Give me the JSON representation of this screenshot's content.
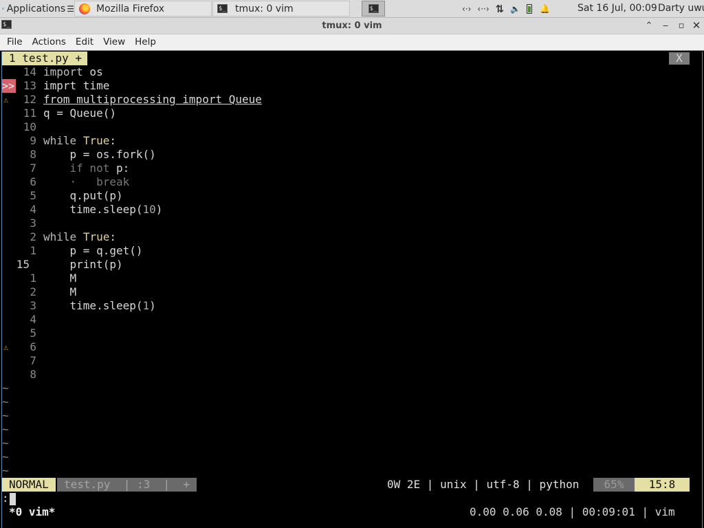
{
  "panel": {
    "applications_label": "Applications",
    "applications_arrow": "☰",
    "tasks": [
      {
        "label": "Mozilla Firefox",
        "icon": "firefox-icon"
      },
      {
        "label": "tmux: 0 vim",
        "icon": "terminal-icon"
      }
    ],
    "terminal_launcher_glyph": "$_",
    "tray": {
      "net1": "‹·›",
      "net2": "‹··›",
      "updown": "⇅",
      "volume": "🔈",
      "bell": "🔔"
    },
    "clock": "Sat 16 Jul, 00:09",
    "user": "Darty uwu"
  },
  "window": {
    "title": "tmux: 0 vim",
    "icon_glyph": "$_",
    "buttons": {
      "minimize": "⌃",
      "restore": "‒",
      "maximize": "▫",
      "close": "✕"
    }
  },
  "menubar": [
    "File",
    "Actions",
    "Edit",
    "View",
    "Help"
  ],
  "vim": {
    "tab_label": "1 test.py +",
    "tab_close": "X",
    "lines": [
      {
        "sign": "",
        "num": "14",
        "code": [
          [
            "import",
            "kw"
          ],
          [
            " os",
            ""
          ]
        ]
      },
      {
        "sign": ">>",
        "num": "13",
        "code": [
          [
            "imprt time",
            ""
          ]
        ]
      },
      {
        "sign": "⚠",
        "num": "12",
        "code": [
          [
            "from multiprocessing import Queue",
            "under"
          ]
        ]
      },
      {
        "sign": "",
        "num": "11",
        "code": [
          [
            "q = Queue()",
            ""
          ]
        ]
      },
      {
        "sign": "",
        "num": "10",
        "code": []
      },
      {
        "sign": "",
        "num": "9",
        "code": [
          [
            "while",
            "kw"
          ],
          [
            " ",
            ""
          ],
          [
            "True",
            "lit"
          ],
          [
            ":",
            ""
          ]
        ]
      },
      {
        "sign": "",
        "num": "8",
        "code": [
          [
            "    p = os.fork()",
            ""
          ]
        ]
      },
      {
        "sign": "",
        "num": "7",
        "code": [
          [
            "    if not ",
            "dim"
          ],
          [
            "p:",
            ""
          ]
        ]
      },
      {
        "sign": "",
        "num": "6",
        "code": [
          [
            "    ·   break",
            "dim"
          ]
        ]
      },
      {
        "sign": "",
        "num": "5",
        "code": [
          [
            "    q.put(p)",
            ""
          ]
        ]
      },
      {
        "sign": "",
        "num": "4",
        "code": [
          [
            "    time.sleep(",
            ""
          ],
          [
            "10",
            "num"
          ],
          [
            ")",
            ""
          ]
        ]
      },
      {
        "sign": "",
        "num": "3",
        "code": []
      },
      {
        "sign": "",
        "num": "2",
        "code": [
          [
            "while",
            "kw"
          ],
          [
            " ",
            ""
          ],
          [
            "True",
            "lit"
          ],
          [
            ":",
            ""
          ]
        ]
      },
      {
        "sign": "",
        "num": "1",
        "code": [
          [
            "    p = q.get()",
            ""
          ]
        ]
      },
      {
        "sign": "",
        "num": "15",
        "current": true,
        "code": [
          [
            "    print(p)",
            ""
          ]
        ]
      },
      {
        "sign": "",
        "num": "1",
        "code": [
          [
            "    M",
            ""
          ]
        ]
      },
      {
        "sign": "",
        "num": "2",
        "code": [
          [
            "    M",
            ""
          ]
        ]
      },
      {
        "sign": "",
        "num": "3",
        "code": [
          [
            "    time.sleep(",
            ""
          ],
          [
            "1",
            "num"
          ],
          [
            ")",
            ""
          ]
        ]
      },
      {
        "sign": "",
        "num": "4",
        "code": []
      },
      {
        "sign": "",
        "num": "5",
        "code": []
      },
      {
        "sign": "⚠",
        "num": "6",
        "code": []
      },
      {
        "sign": "",
        "num": "7",
        "code": []
      },
      {
        "sign": "",
        "num": "8",
        "code": []
      }
    ],
    "tilde_rows": [
      "~",
      "~",
      "~",
      "~",
      "~",
      "~",
      "~"
    ],
    "statusline": {
      "mode": "NORMAL",
      "file": "test.py  | :3  |  +",
      "info": "0W 2E | unix | utf-8 | python",
      "percent": "65%",
      "position": "15:8"
    },
    "cmdline": ":"
  },
  "tmux": {
    "left": "*0 vim*",
    "right": "0.00 0.06 0.08 | 00:09:01 | vim"
  }
}
